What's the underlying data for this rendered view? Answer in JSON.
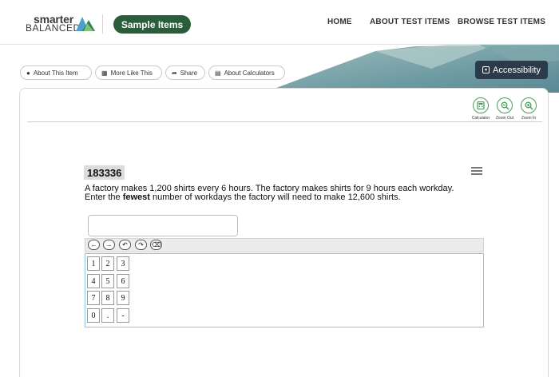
{
  "header": {
    "logo_top": "smarter",
    "logo_bottom": "BALANCED",
    "sample_items": "Sample Items",
    "nav": {
      "home": "HOME",
      "about": "ABOUT TEST ITEMS",
      "browse": "BROWSE TEST ITEMS"
    }
  },
  "toolbar": {
    "about_item": "About This Item",
    "more_like_this": "More Like This",
    "share": "Share",
    "about_calculators": "About Calculators",
    "accessibility": "Accessibility"
  },
  "item_tools": {
    "calculator": "Calculator",
    "zoom_out": "Zoom Out",
    "zoom_in": "Zoom In"
  },
  "item": {
    "id": "183336",
    "question_part1": "A factory makes 1,200 shirts every 6 hours. The factory makes shirts for 9 hours each workday.",
    "question_part2_pre": "Enter the ",
    "question_bold": "fewest",
    "question_part2_post": " number of workdays the factory will need to make 12,600 shirts.",
    "answer_value": ""
  },
  "keypad": {
    "toolbar_keys": [
      "left-arrow",
      "right-arrow",
      "undo",
      "redo",
      "backspace"
    ],
    "keys": [
      "1",
      "2",
      "3",
      "4",
      "5",
      "6",
      "7",
      "8",
      "9",
      "0",
      ".",
      "-"
    ]
  },
  "colors": {
    "brand_green": "#2a5d3a",
    "tool_green": "#4a9a5c",
    "accessibility_bg": "#2c3b4a",
    "keypad_border": "#8ec3e3"
  }
}
